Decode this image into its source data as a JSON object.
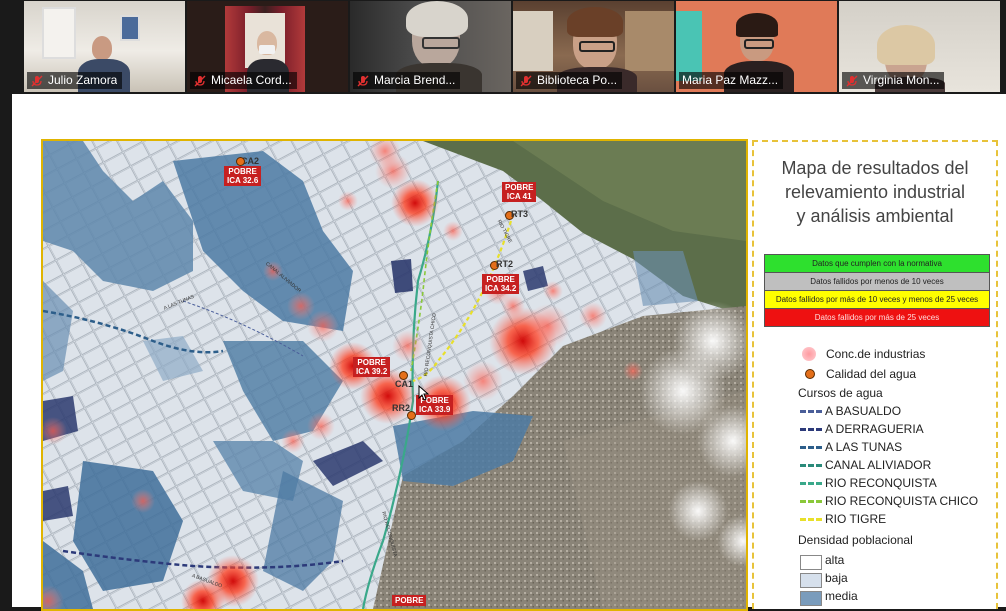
{
  "participants": [
    {
      "name": "Julio Zamora",
      "muted": true
    },
    {
      "name": "Micaela Cord...",
      "muted": true
    },
    {
      "name": "Marcia Brend...",
      "muted": true
    },
    {
      "name": "Biblioteca Po...",
      "muted": true
    },
    {
      "name": "Maria Paz Mazz...",
      "muted": false,
      "active_speaker": true
    },
    {
      "name": "Virginia Mon...",
      "muted": true
    }
  ],
  "legend": {
    "title_lines": [
      "Mapa de resultados del",
      "relevamiento industrial",
      "y análisis ambiental"
    ],
    "table": [
      {
        "label": "Datos que cumplen con la normativa",
        "color": "#2ee02e"
      },
      {
        "label": "Datos fallidos por menos de 10 veces",
        "color": "#bfbfbf"
      },
      {
        "label": "Datos fallidos por más de 10 veces y menos de 25 veces",
        "color": "#ffff00"
      },
      {
        "label": "Datos fallidos por más de 25 veces",
        "color": "#ee1111"
      }
    ],
    "industrias": "Conc.de industrias",
    "calidad": "Calidad del agua",
    "cursos_title": "Cursos de agua",
    "cursos": [
      {
        "label": "A BASUALDO",
        "color": "#4a5e99"
      },
      {
        "label": "A DERRAGUERIA",
        "color": "#2c3a7a"
      },
      {
        "label": "A LAS TUNAS",
        "color": "#2d5e8a"
      },
      {
        "label": "CANAL ALIVIADOR",
        "color": "#2a8a7a"
      },
      {
        "label": "RIO RECONQUISTA",
        "color": "#3aa88a"
      },
      {
        "label": "RIO RECONQUISTA CHICO",
        "color": "#8ac83a"
      },
      {
        "label": "RIO TIGRE",
        "color": "#e8e02a"
      }
    ],
    "densidad_title": "Densidad poblacional",
    "densidad": [
      {
        "label": "alta",
        "color": "#ffffff"
      },
      {
        "label": "baja",
        "color": "#d6e0ec"
      },
      {
        "label": "media",
        "color": "#7a9cbc"
      }
    ]
  },
  "map": {
    "labels": [
      {
        "id": "ca2",
        "tag": "CA2",
        "line1": "POBRE",
        "line2": "ICA 32.6"
      },
      {
        "id": "rt3",
        "tag": "RT3",
        "line1": "POBRE",
        "line2": "ICA 41"
      },
      {
        "id": "rt2",
        "tag": "RT2",
        "line1": "POBRE",
        "line2": "ICA 34.2"
      },
      {
        "id": "ca1",
        "tag": "CA1",
        "line1": "POBRE",
        "line2": "ICA 39.2"
      },
      {
        "id": "rr2",
        "tag": "RR2",
        "line1": "POBRE",
        "line2": "ICA 33.9"
      },
      {
        "id": "bottom",
        "tag": "",
        "line1": "POBRE",
        "line2": ""
      }
    ],
    "street_labels": [
      "RIO RECONQUISTA CHICO",
      "RIO TIGRE",
      "RIO RECONQUISTA",
      "A LAS TUNAS",
      "A BASUALDO",
      "CANAL ALIVIADOR"
    ]
  }
}
